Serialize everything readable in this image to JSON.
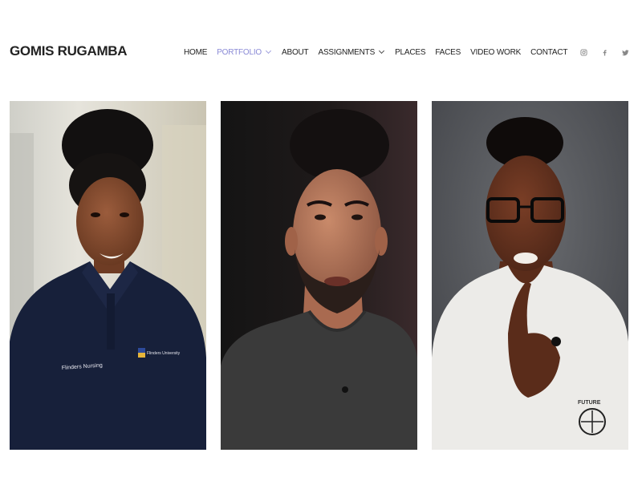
{
  "site": {
    "title": "GOMIS RUGAMBA"
  },
  "nav": {
    "items": [
      {
        "label": "HOME",
        "active": false,
        "dropdown": false
      },
      {
        "label": "PORTFOLIO",
        "active": true,
        "dropdown": true
      },
      {
        "label": "ABOUT",
        "active": false,
        "dropdown": false
      },
      {
        "label": "ASSIGNMENTS",
        "active": false,
        "dropdown": true
      },
      {
        "label": "PLACES",
        "active": false,
        "dropdown": false
      },
      {
        "label": "FACES",
        "active": false,
        "dropdown": false
      },
      {
        "label": "VIDEO WORK",
        "active": false,
        "dropdown": false
      },
      {
        "label": "CONTACT",
        "active": false,
        "dropdown": false
      }
    ],
    "active_color": "#8a8ad6"
  },
  "social": {
    "icons": [
      "instagram-icon",
      "facebook-icon",
      "twitter-icon"
    ]
  },
  "gallery": {
    "photos": [
      {
        "name": "portrait-woman-nursing-polo",
        "shirt_text": "Flinders Nursing",
        "logo_text": "Flinders University"
      },
      {
        "name": "portrait-man-dark-tshirt"
      },
      {
        "name": "portrait-man-glasses-white-shirt",
        "shirt_text": "FUTURE"
      }
    ]
  }
}
